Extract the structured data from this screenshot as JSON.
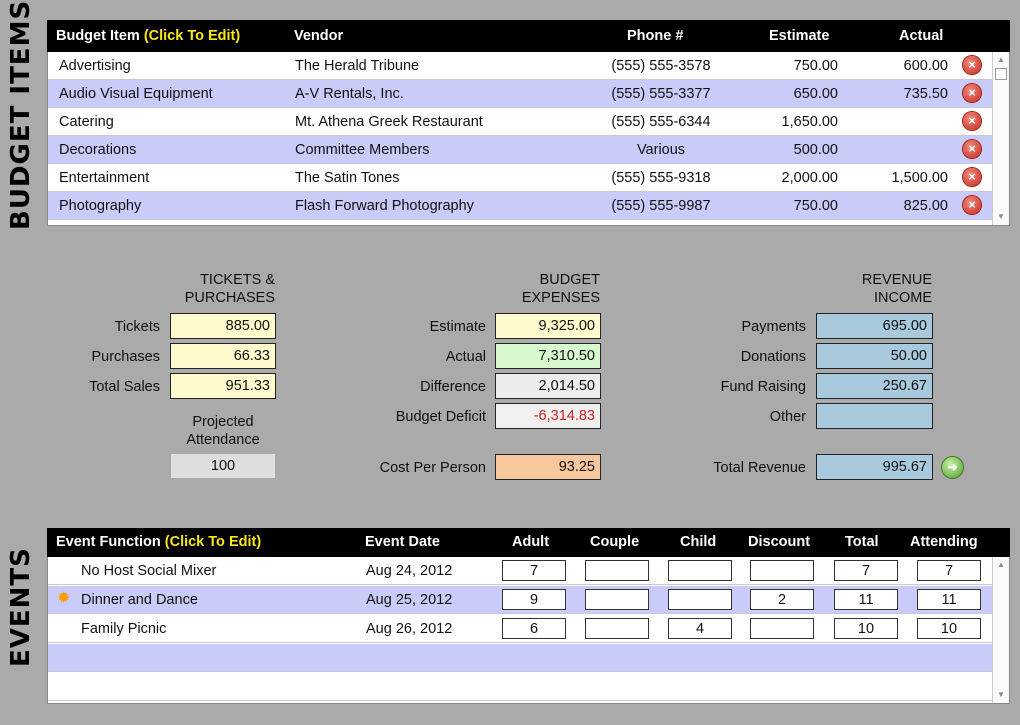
{
  "labels": {
    "budget_items": "BUDGET ITEMS",
    "events": "EVENTS"
  },
  "budget": {
    "headers": {
      "item": "Budget Item",
      "edit": "(Click To Edit)",
      "vendor": "Vendor",
      "phone": "Phone #",
      "estimate": "Estimate",
      "actual": "Actual"
    },
    "rows": [
      {
        "item": "Advertising",
        "vendor": "The Herald Tribune",
        "phone": "(555) 555-3578",
        "estimate": "750.00",
        "actual": "600.00"
      },
      {
        "item": "Audio Visual Equipment",
        "vendor": "A-V Rentals, Inc.",
        "phone": "(555) 555-3377",
        "estimate": "650.00",
        "actual": "735.50"
      },
      {
        "item": "Catering",
        "vendor": "Mt. Athena Greek Restaurant",
        "phone": "(555) 555-6344",
        "estimate": "1,650.00",
        "actual": ""
      },
      {
        "item": "Decorations",
        "vendor": "Committee Members",
        "phone": "Various",
        "estimate": "500.00",
        "actual": ""
      },
      {
        "item": "Entertainment",
        "vendor": "The Satin Tones",
        "phone": "(555) 555-9318",
        "estimate": "2,000.00",
        "actual": "1,500.00"
      },
      {
        "item": "Photography",
        "vendor": "Flash Forward Photography",
        "phone": "(555) 555-9987",
        "estimate": "750.00",
        "actual": "825.00"
      }
    ]
  },
  "tickets": {
    "heading": "TICKETS &\nPURCHASES",
    "tickets_label": "Tickets",
    "tickets": "885.00",
    "purchases_label": "Purchases",
    "purchases": "66.33",
    "total_label": "Total Sales",
    "total": "951.33",
    "projected_label": "Projected\nAttendance",
    "projected": "100"
  },
  "expenses": {
    "heading": "BUDGET\nEXPENSES",
    "estimate_label": "Estimate",
    "estimate": "9,325.00",
    "actual_label": "Actual",
    "actual": "7,310.50",
    "difference_label": "Difference",
    "difference": "2,014.50",
    "deficit_label": "Budget Deficit",
    "deficit": "-6,314.83",
    "cpp_label": "Cost Per Person",
    "cpp": "93.25"
  },
  "revenue": {
    "heading": "REVENUE\nINCOME",
    "payments_label": "Payments",
    "payments": "695.00",
    "donations_label": "Donations",
    "donations": "50.00",
    "fund_label": "Fund Raising",
    "fund": "250.67",
    "other_label": "Other",
    "other": "",
    "total_label": "Total Revenue",
    "total": "995.67"
  },
  "events": {
    "headers": {
      "fn": "Event Function",
      "edit": "(Click To Edit)",
      "date": "Event Date",
      "adult": "Adult",
      "couple": "Couple",
      "child": "Child",
      "discount": "Discount",
      "total": "Total",
      "attending": "Attending"
    },
    "rows": [
      {
        "fn": "No Host Social Mixer",
        "date": "Aug 24, 2012",
        "adult": "7",
        "couple": "",
        "child": "",
        "discount": "",
        "total": "7",
        "attending": "7"
      },
      {
        "fn": "Dinner and Dance",
        "date": "Aug 25, 2012",
        "adult": "9",
        "couple": "",
        "child": "",
        "discount": "2",
        "total": "11",
        "attending": "11"
      },
      {
        "fn": "Family Picnic",
        "date": "Aug 26, 2012",
        "adult": "6",
        "couple": "",
        "child": "4",
        "discount": "",
        "total": "10",
        "attending": "10"
      }
    ]
  },
  "colors": {
    "row_alt": "#c9cbf9",
    "header_bg": "#000000",
    "edit_hint": "#f8e71c",
    "deficit": "#cc2222"
  },
  "icons": {
    "delete": "delete-circle-icon",
    "go": "green-arrow-icon",
    "selected": "sun-icon"
  }
}
